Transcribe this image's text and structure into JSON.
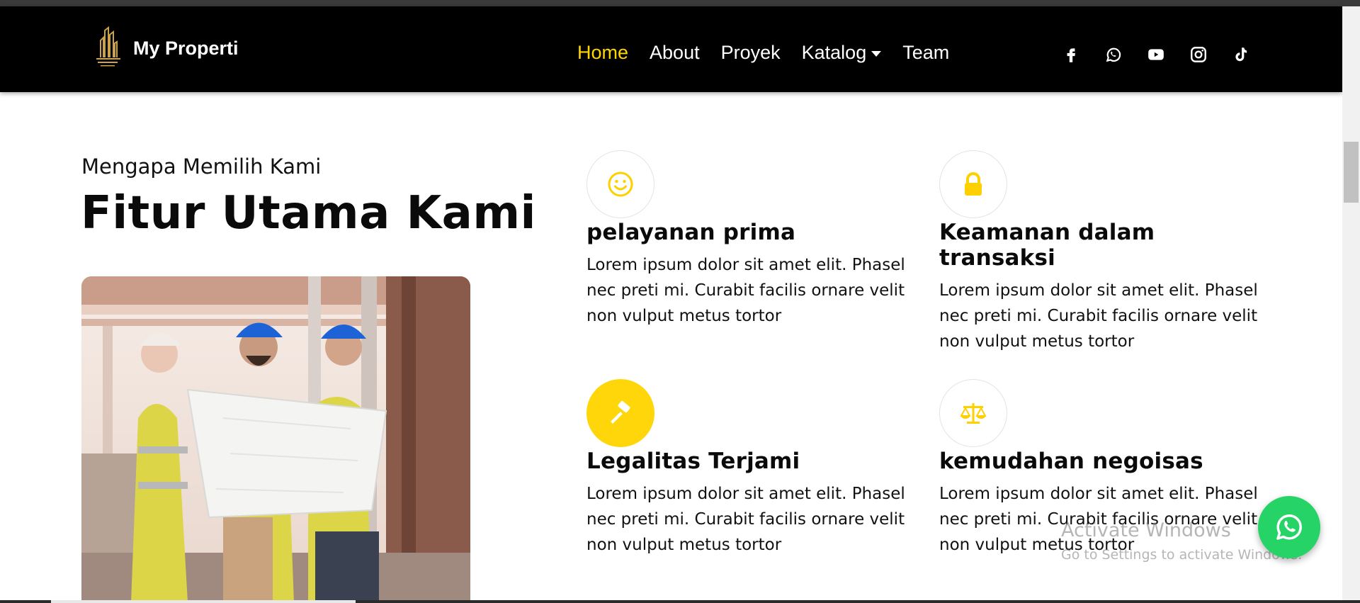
{
  "brand": {
    "name": "My Properti",
    "logo_icon": "building-logo"
  },
  "nav": {
    "items": [
      {
        "label": "Home",
        "active": true
      },
      {
        "label": "About"
      },
      {
        "label": "Proyek"
      },
      {
        "label": "Katalog",
        "dropdown": true
      },
      {
        "label": "Team"
      }
    ],
    "active_color": "#ffd700"
  },
  "social": [
    "facebook-icon",
    "whatsapp-icon",
    "youtube-icon",
    "instagram-icon",
    "tiktok-icon"
  ],
  "section": {
    "subtitle": "Mengapa Memilih Kami",
    "title": "Fitur Utama Kami"
  },
  "features": [
    {
      "icon": "smile-icon",
      "title": "pelayanan prima",
      "desc": "Lorem ipsum dolor sit amet elit. Phasel nec preti mi. Curabit facilis ornare velit non vulput metus tortor"
    },
    {
      "icon": "lock-icon",
      "title": "Keamanan dalam transaksi",
      "desc": "Lorem ipsum dolor sit amet elit. Phasel nec preti mi. Curabit facilis ornare velit non vulput metus tortor"
    },
    {
      "icon": "gavel-icon",
      "title": "Legalitas Terjami",
      "desc": "Lorem ipsum dolor sit amet elit. Phasel nec preti mi. Curabit facilis ornare velit non vulput metus tortor"
    },
    {
      "icon": "balance-scale-icon",
      "title": "kemudahan negoisas",
      "desc": "Lorem ipsum dolor sit amet elit. Phasel nec preti mi. Curabit facilis ornare velit non vulput metus tortor"
    }
  ],
  "watermark": {
    "line1": "Activate Windows",
    "line2": "Go to Settings to activate Windows."
  },
  "colors": {
    "accent": "#ffd60a",
    "whatsapp": "#25d366",
    "navbar": "#000000"
  }
}
